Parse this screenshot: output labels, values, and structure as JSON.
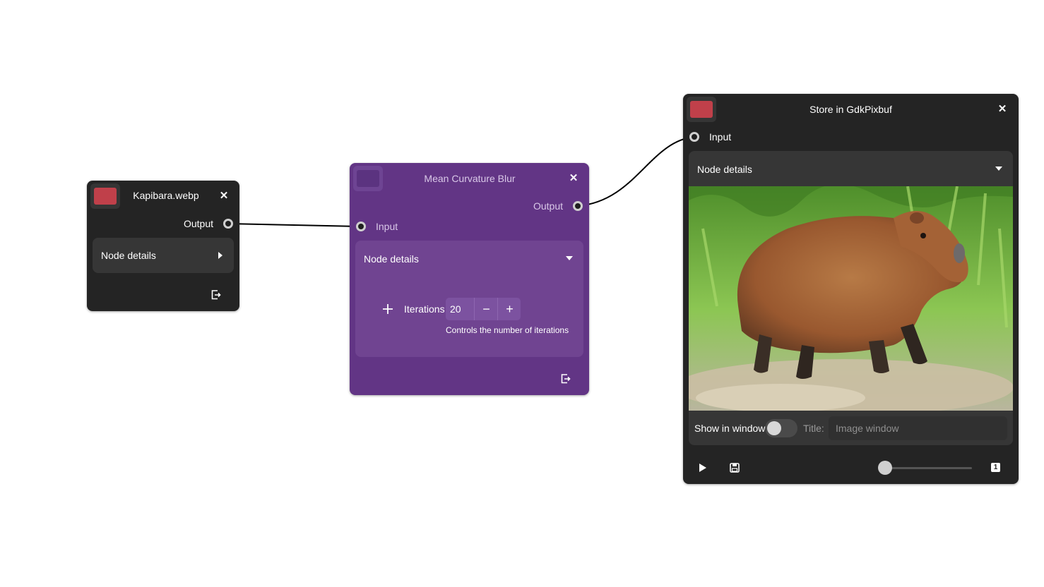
{
  "nodes": {
    "kapibara": {
      "title": "Kapibara.webp",
      "output_label": "Output",
      "details_label": "Node details",
      "swatch_color": "#c0404a"
    },
    "blur": {
      "title": "Mean Curvature Blur",
      "output_label": "Output",
      "input_label": "Input",
      "details_label": "Node details",
      "iterations_label": "Iterations",
      "iterations_value": "20",
      "iterations_help": "Controls the number of iterations",
      "background_color": "#623585"
    },
    "store": {
      "title": "Store in GdkPixbuf",
      "input_label": "Input",
      "details_label": "Node details",
      "show_in_window_label": "Show in window",
      "show_in_window_enabled": false,
      "title_label": "Title:",
      "title_placeholder": "Image window",
      "swatch_color": "#c0404a",
      "page_badge": "1"
    }
  },
  "icons": {
    "close": "close-icon",
    "export": "export-icon",
    "play": "play-icon",
    "save": "save-icon",
    "add": "add-icon"
  }
}
